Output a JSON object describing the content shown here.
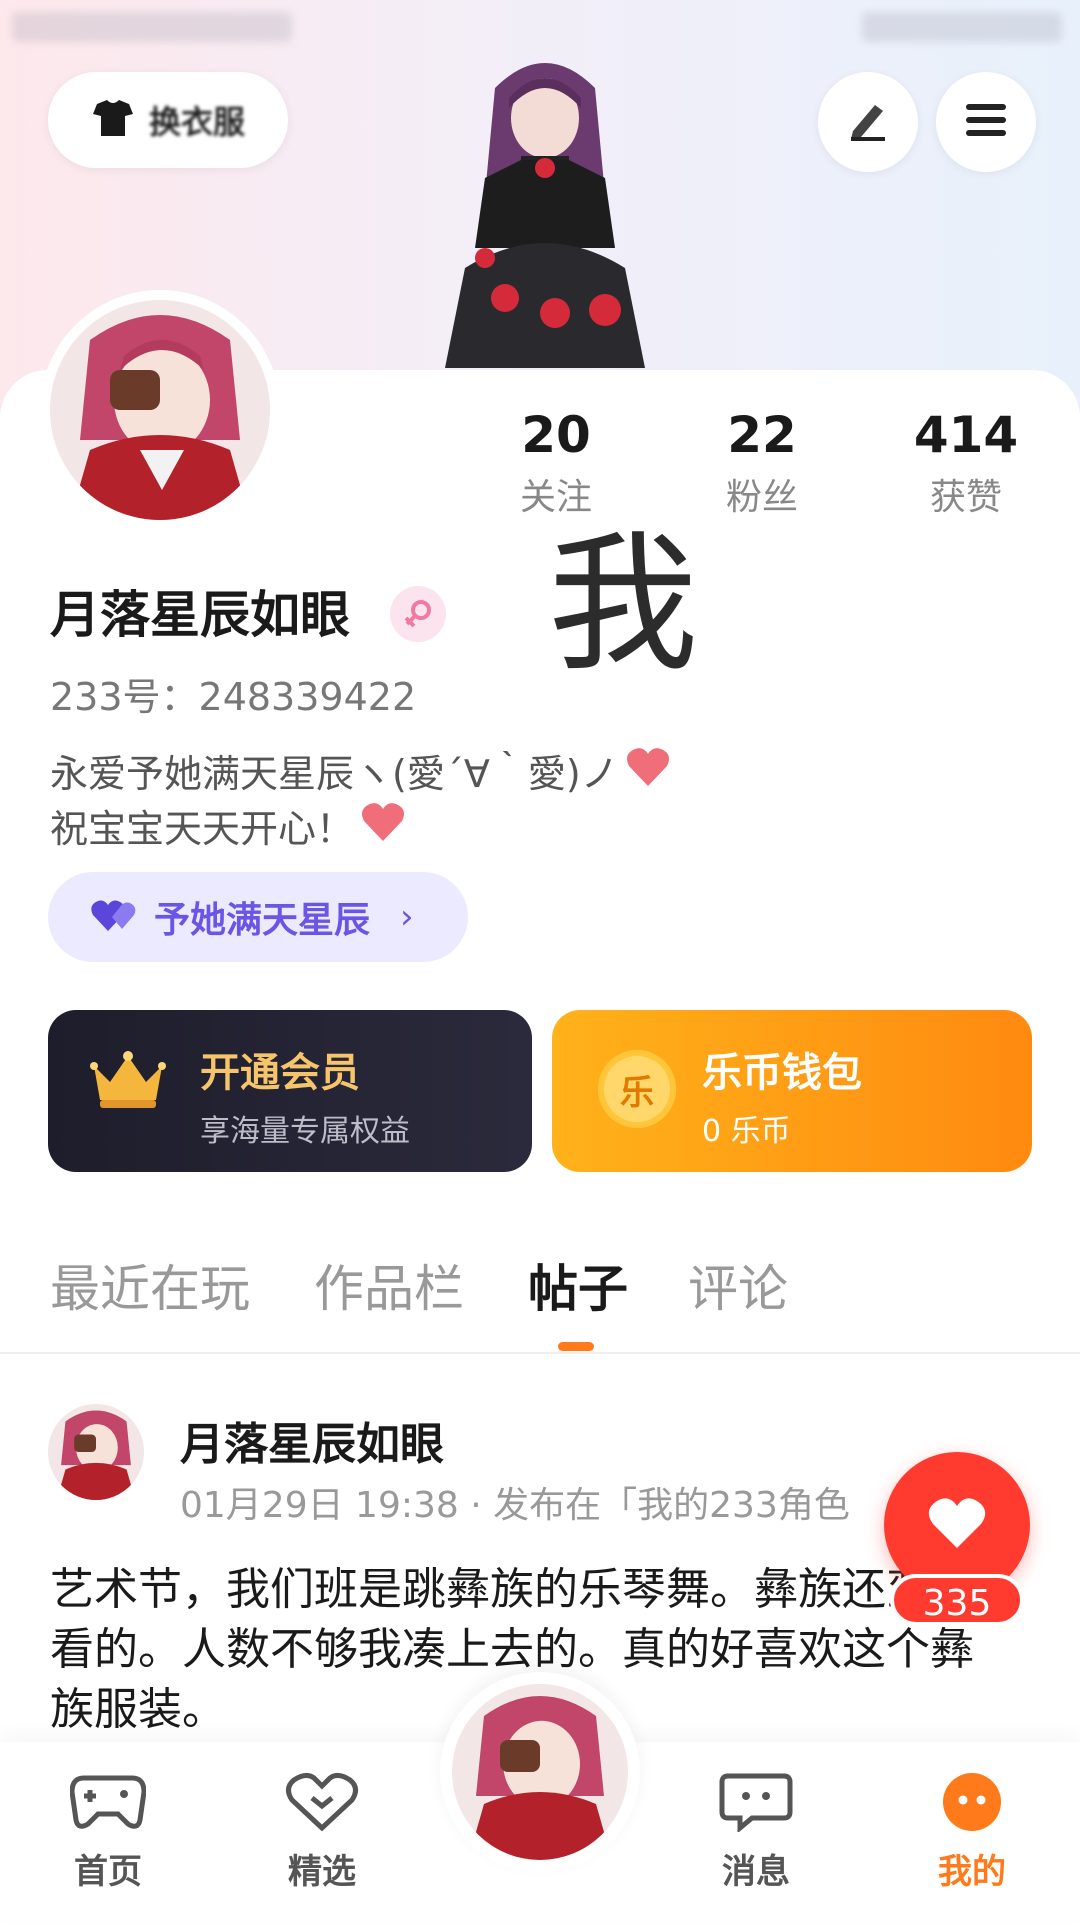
{
  "header": {
    "outfit_button_label": "换衣服"
  },
  "profile": {
    "username": "月落星辰如眼",
    "uid": "233号：248339422",
    "bio_line1": "永爱予她满天星辰ヽ(愛´∀｀愛)ノ",
    "bio_line2": "祝宝宝天天开心！",
    "tag": "予她满天星辰",
    "overlay_text": "我",
    "stats": [
      {
        "value": "20",
        "label": "关注"
      },
      {
        "value": "22",
        "label": "粉丝"
      },
      {
        "value": "414",
        "label": "获赞"
      }
    ]
  },
  "cards": {
    "vip_title": "开通会员",
    "vip_subtitle": "享海量专属权益",
    "wallet_title": "乐币钱包",
    "wallet_subtitle": "0 乐币",
    "coin_glyph": "乐"
  },
  "tabs": [
    "最近在玩",
    "作品栏",
    "帖子",
    "评论"
  ],
  "active_tab": "帖子",
  "post": {
    "author": "月落星辰如眼",
    "meta": "01月29日 19:38 · 发布在「我的233角色",
    "text": "艺术节，我们班是跳彝族的乐琴舞。彝族还蛮好看的。人数不够我凑上去的。真的好喜欢这个彝族服装。",
    "like_count": "335"
  },
  "nav": {
    "items": [
      "首页",
      "精选",
      "消息",
      "我的"
    ],
    "active": "我的"
  },
  "colors": {
    "accent": "#ff7a1a",
    "like": "#ff3b30",
    "tag": "#6a55e6",
    "vip_gold": "#f6c46a"
  }
}
